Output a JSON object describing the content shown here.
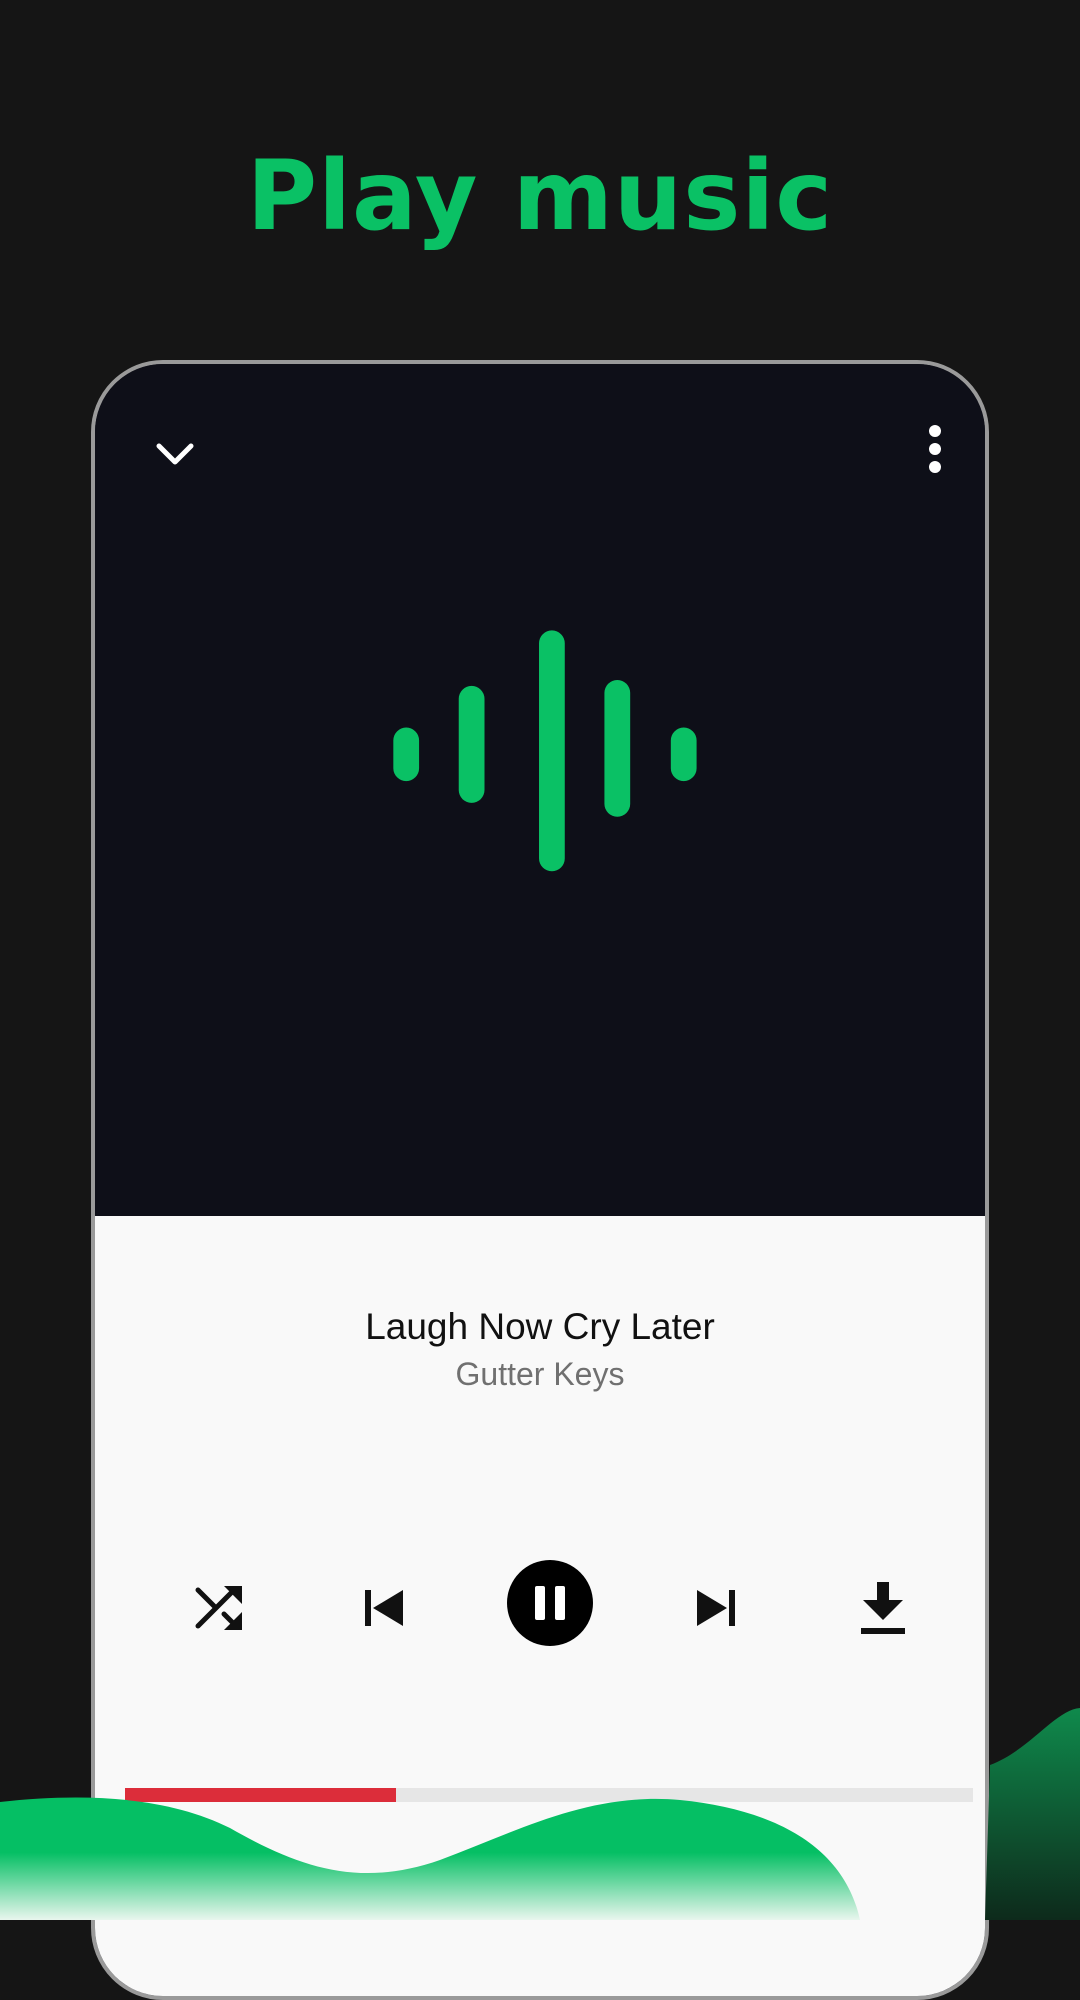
{
  "headline": "Play music",
  "player": {
    "track_title": "Laugh Now Cry Later",
    "artist": "Gutter Keys",
    "progress": 0.32,
    "is_playing": true
  },
  "icons": {
    "collapse": "chevron-down-icon",
    "menu": "more-vertical-icon",
    "artwork": "sound-wave-icon",
    "shuffle": "shuffle-icon",
    "previous": "skip-previous-icon",
    "play_pause": "pause-icon",
    "next": "skip-next-icon",
    "download": "download-icon"
  },
  "colors": {
    "accent": "#0ac165",
    "background": "#151515",
    "player_dark": "#0e0f18",
    "player_light": "#f9f9f9",
    "progress": "#dc2d3a"
  }
}
